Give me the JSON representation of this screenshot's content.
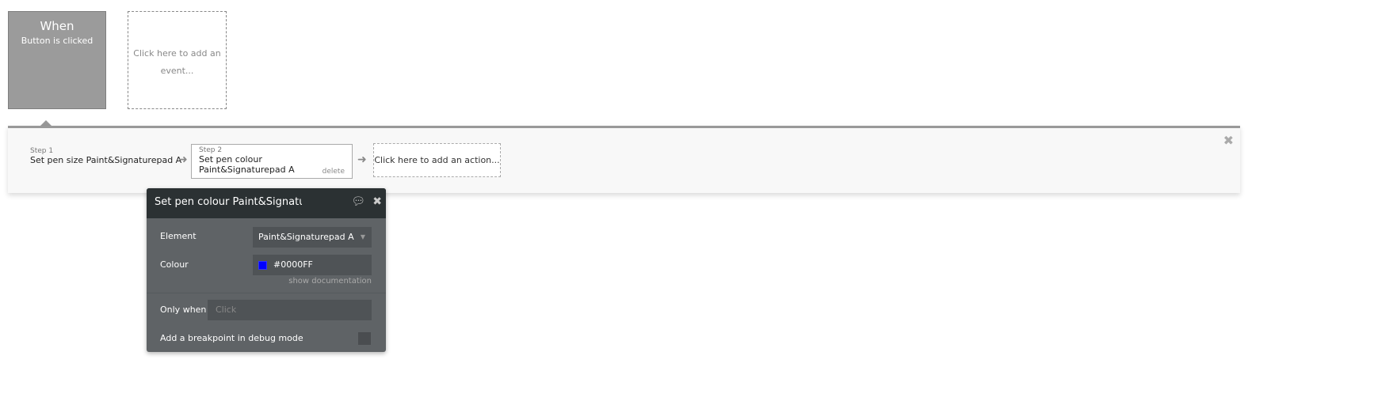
{
  "event": {
    "title": "When",
    "subtitle": "Button is clicked"
  },
  "add_event": "Click here to add an event...",
  "steps": [
    {
      "label": "Step 1",
      "title": "Set pen size Paint&Signaturepad A"
    },
    {
      "label": "Step 2",
      "title": "Set pen colour Paint&Signaturepad A",
      "delete": "delete"
    }
  ],
  "add_action": "Click here to add an action...",
  "popup": {
    "title": "Set pen colour Paint&Signaturepad A",
    "element_label": "Element",
    "element_value": "Paint&Signaturepad A",
    "colour_label": "Colour",
    "colour_value": "#0000FF",
    "colour_swatch": "#0000FF",
    "show_doc": "show documentation",
    "only_when_label": "Only when",
    "only_when_placeholder": "Click",
    "breakpoint_label": "Add a breakpoint in debug mode"
  }
}
